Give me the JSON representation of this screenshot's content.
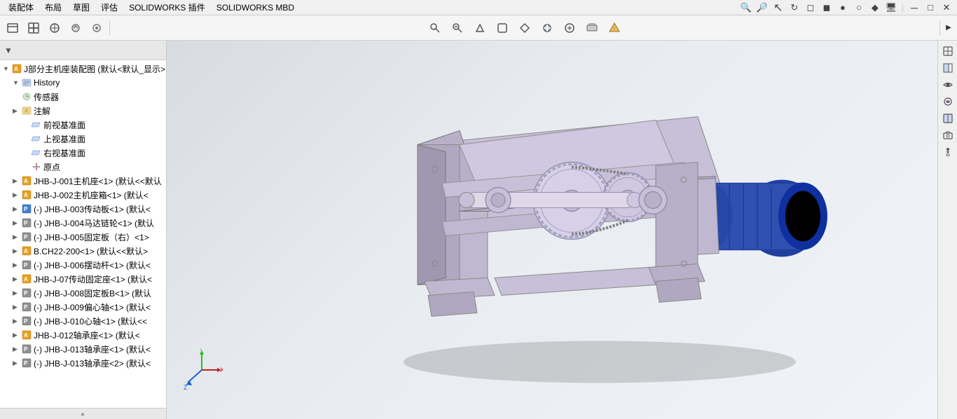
{
  "menuBar": {
    "items": [
      "装配体",
      "布局",
      "草图",
      "评估",
      "SOLIDWORKS 插件",
      "SOLIDWORKS MBD"
    ]
  },
  "toolbar": {
    "buttons": [
      {
        "name": "new",
        "icon": "📄"
      },
      {
        "name": "open",
        "icon": "📂"
      },
      {
        "name": "save",
        "icon": "💾"
      },
      {
        "name": "print",
        "icon": "🖨"
      },
      {
        "name": "settings",
        "icon": "⚙"
      }
    ],
    "moreArrow": "▶"
  },
  "topIcons": [
    {
      "name": "search",
      "icon": "🔍"
    },
    {
      "name": "zoom",
      "icon": "🔎"
    },
    {
      "name": "cursor",
      "icon": "↖"
    },
    {
      "name": "rotate",
      "icon": "↻"
    },
    {
      "name": "box1",
      "icon": "◻"
    },
    {
      "name": "box2",
      "icon": "◼"
    },
    {
      "name": "dot",
      "icon": "●"
    },
    {
      "name": "circle",
      "icon": "○"
    },
    {
      "name": "diamond",
      "icon": "◆"
    },
    {
      "name": "monitor",
      "icon": "🖥"
    },
    {
      "name": "sep",
      "icon": "|"
    },
    {
      "name": "maximize",
      "icon": "⊞"
    },
    {
      "name": "restore",
      "icon": "⊟"
    },
    {
      "name": "minimize2",
      "icon": "─"
    },
    {
      "name": "close2",
      "icon": "✕"
    }
  ],
  "windowControls": {
    "minimize": "─",
    "maximize": "□",
    "close": "✕"
  },
  "leftPanel": {
    "filterIcon": "▼",
    "rootNode": {
      "label": "J部分主机座装配图 (默认<默认_显示>"
    },
    "treeItems": [
      {
        "indent": 1,
        "hasArrow": true,
        "arrowDown": true,
        "iconType": "history",
        "label": "History"
      },
      {
        "indent": 1,
        "hasArrow": false,
        "arrowDown": false,
        "iconType": "sensor",
        "label": "传感器"
      },
      {
        "indent": 1,
        "hasArrow": true,
        "arrowDown": false,
        "iconType": "annotation",
        "label": "注解"
      },
      {
        "indent": 2,
        "hasArrow": false,
        "arrowDown": false,
        "iconType": "plane",
        "label": "前视基准面"
      },
      {
        "indent": 2,
        "hasArrow": false,
        "arrowDown": false,
        "iconType": "plane",
        "label": "上视基准面"
      },
      {
        "indent": 2,
        "hasArrow": false,
        "arrowDown": false,
        "iconType": "plane",
        "label": "右视基准面"
      },
      {
        "indent": 2,
        "hasArrow": false,
        "arrowDown": false,
        "iconType": "origin",
        "label": "原点"
      },
      {
        "indent": 1,
        "hasArrow": true,
        "arrowDown": false,
        "iconType": "part-orange",
        "label": "JHB-J-001主机座<1> (默认<<默认"
      },
      {
        "indent": 1,
        "hasArrow": true,
        "arrowDown": false,
        "iconType": "part-orange",
        "label": "JHB-J-002主机座箱<1> (默认<"
      },
      {
        "indent": 1,
        "hasArrow": true,
        "arrowDown": false,
        "iconType": "part-blue",
        "label": "(-) JHB-J-003传动板<1> (默认<"
      },
      {
        "indent": 1,
        "hasArrow": true,
        "arrowDown": false,
        "iconType": "part-gray",
        "label": "(-) JHB-J-004马达链轮<1> (默认"
      },
      {
        "indent": 1,
        "hasArrow": true,
        "arrowDown": false,
        "iconType": "part-gray",
        "label": "(-) JHB-J-005固定板（右）<1>"
      },
      {
        "indent": 1,
        "hasArrow": true,
        "arrowDown": false,
        "iconType": "part-orange",
        "label": "B.CH22-200<1> (默认<<默认>"
      },
      {
        "indent": 1,
        "hasArrow": true,
        "arrowDown": false,
        "iconType": "part-gray",
        "label": "(-) JHB-J-006摆动杆<1> (默认<"
      },
      {
        "indent": 1,
        "hasArrow": true,
        "arrowDown": false,
        "iconType": "part-orange",
        "label": "JHB-J-07传动固定座<1> (默认<"
      },
      {
        "indent": 1,
        "hasArrow": true,
        "arrowDown": false,
        "iconType": "part-gray",
        "label": "(-) JHB-J-008固定板B<1> (默认"
      },
      {
        "indent": 1,
        "hasArrow": true,
        "arrowDown": false,
        "iconType": "part-gray",
        "label": "(-) JHB-J-009偏心轴<1> (默认<"
      },
      {
        "indent": 1,
        "hasArrow": true,
        "arrowDown": false,
        "iconType": "part-gray",
        "label": "(-) JHB-J-010心轴<1> (默认<<"
      },
      {
        "indent": 1,
        "hasArrow": true,
        "arrowDown": false,
        "iconType": "part-orange",
        "label": "JHB-J-012轴承座<1> (默认<"
      },
      {
        "indent": 1,
        "hasArrow": true,
        "arrowDown": false,
        "iconType": "part-gray",
        "label": "(-) JHB-J-013轴承座<1> (默认<"
      },
      {
        "indent": 1,
        "hasArrow": true,
        "arrowDown": false,
        "iconType": "part-gray",
        "label": "(-) JHB-J-013轴承座<2> (默认<"
      }
    ]
  },
  "rightToolbar": {
    "buttons": [
      {
        "name": "view-orient",
        "icon": "⊹"
      },
      {
        "name": "display-style",
        "icon": "◧"
      },
      {
        "name": "hide-show",
        "icon": "👁"
      },
      {
        "name": "edit-appear",
        "icon": "🎨"
      },
      {
        "name": "section-view",
        "icon": "◩"
      },
      {
        "name": "camera",
        "icon": "📷"
      },
      {
        "name": "walk",
        "icon": "⇔"
      }
    ]
  },
  "statusBar": {
    "bottomArrow": "▲"
  }
}
